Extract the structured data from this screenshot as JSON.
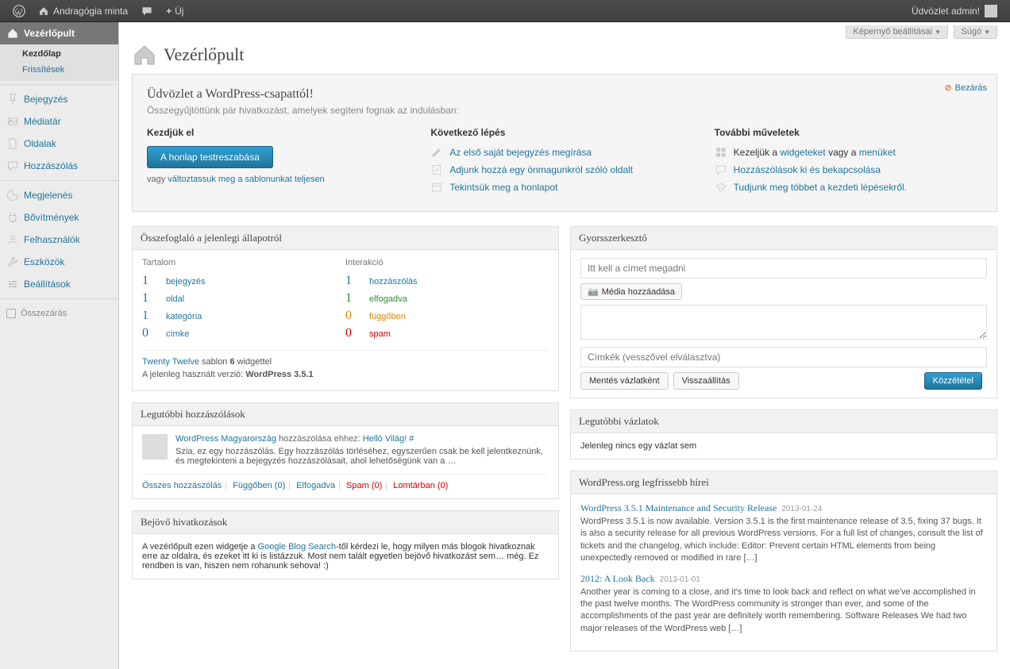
{
  "toolbar": {
    "site_name": "Andragógia minta",
    "new_label": "Új",
    "howdy": "Üdvözlet admin!"
  },
  "screen_meta": {
    "screen_options": "Képernyő beállításai",
    "help": "Súgó"
  },
  "page_title": "Vezérlőpult",
  "menu": {
    "dashboard": "Vezérlőpult",
    "home": "Kezdőlap",
    "updates": "Frissítések",
    "posts": "Bejegyzés",
    "media": "Médiatár",
    "pages": "Oldalak",
    "comments": "Hozzászólás",
    "appearance": "Megjelenés",
    "plugins": "Bővítmények",
    "users": "Felhasználók",
    "tools": "Eszközök",
    "settings": "Beállítások",
    "collapse": "Összezárás"
  },
  "welcome": {
    "title": "Üdvözlet a WordPress-csapattól!",
    "sub": "Összegyűjtöttünk pár hivatkozást, amelyek segíteni fognak az indulásban:",
    "close": "Bezárás",
    "col1_title": "Kezdjük el",
    "customize_btn": "A honlap testreszabása",
    "or_prefix": "vagy ",
    "or_link": "változtassuk meg a sablonunkat teljesen",
    "col2_title": "Következő lépés",
    "c2_l1": "Az első saját bejegyzés megírása",
    "c2_l2": "Adjunk hozzá egy önmagunkról szóló oldalt",
    "c2_l3": "Tekintsük meg a honlapot",
    "col3_title": "További műveletek",
    "c3_prefix": "Kezeljük a ",
    "c3_widgets": "widgeteket",
    "c3_or": " vagy a ",
    "c3_menus": "menüket",
    "c3_l2": "Hozzászólások ki és bekapcsolása",
    "c3_l3": "Tudjunk meg többet a kezdeti lépésekről."
  },
  "rightnow": {
    "title": "Összefoglaló a jelenlegi állapotról",
    "content_h": "Tartalom",
    "discuss_h": "Interakció",
    "rows_content": [
      {
        "n": "1",
        "l": "bejegyzés"
      },
      {
        "n": "1",
        "l": "oldal"
      },
      {
        "n": "1",
        "l": "kategória"
      },
      {
        "n": "0",
        "l": "címke"
      }
    ],
    "rows_disc": [
      {
        "n": "1",
        "l": "hozzászólás",
        "c": ""
      },
      {
        "n": "1",
        "l": "elfogadva",
        "c": "green"
      },
      {
        "n": "0",
        "l": "függőben",
        "c": "orange"
      },
      {
        "n": "0",
        "l": "spam",
        "c": "red"
      }
    ],
    "theme_name": "Twenty Twelve",
    "theme_mid": " sablon ",
    "widget_count": "6",
    "theme_suffix": " widgettel",
    "version_prefix": "A jelenleg használt verzió: ",
    "version": "WordPress 3.5.1"
  },
  "recent_comments": {
    "title": "Legutóbbi hozzászólások",
    "author": "WordPress Magyarország",
    "meta_mid": " hozzászólása ehhez: ",
    "post": "Helló Világ! #",
    "text": "Szia, ez egy hozzászólás. Egy hozzászólás törléséhez, egyszerűen csak be kell jelentkeznünk, és megtekinteni a bejegyzés hozzászólásait, ahol lehetőségünk van a …",
    "all": "Összes hozzászólás",
    "pending": "Függőben",
    "pending_n": "(0)",
    "approved": "Elfogadva",
    "spam": "Spam",
    "spam_n": "(0)",
    "trash": "Lomtárban",
    "trash_n": "(0)"
  },
  "incoming": {
    "title": "Bejövő hivatkozások",
    "text_pre": "A vezérlőpult ezen widgetje a ",
    "link": "Google Blog Search",
    "text_post": "-től kérdezi le, hogy milyen más blogok hivatkoznak erre az oldalra, és ezeket itt ki is listázzuk. Most nem talált egyetlen bejövő hivatkozást sem… még. Ez rendben is van, hiszen nem rohanunk sehova! :)"
  },
  "quickpress": {
    "title": "Gyorsszerkesztő",
    "title_ph": "Itt kell a címet megadni",
    "media": "Média hozzáadása",
    "tags_ph": "Címkék (vesszővel elválasztva)",
    "save": "Mentés vázlatként",
    "reset": "Visszaállítás",
    "publish": "Közzététel"
  },
  "drafts": {
    "title": "Legutóbbi vázlatok",
    "empty": "Jelenleg nincs egy vázlat sem"
  },
  "news": {
    "title": "WordPress.org legfrissebb hírei",
    "items": [
      {
        "title": "WordPress 3.5.1 Maintenance and Security Release",
        "date": "2013-01-24",
        "excerpt": "WordPress 3.5.1 is now available. Version 3.5.1 is the first maintenance release of 3.5, fixing 37 bugs. It is also a security release for all previous WordPress versions. For a full list of changes, consult the list of tickets and the changelog, which include: Editor: Prevent certain HTML elements from being unexpectedly removed or modified in rare […]"
      },
      {
        "title": "2012: A Look Back",
        "date": "2013-01-01",
        "excerpt": "Another year is coming to a close, and it's time to look back and reflect on what we've accomplished in the past twelve months. The WordPress community is stronger than ever, and some of the accomplishments of the past year are definitely worth remembering. Software Releases We had two major releases of the WordPress web […]"
      }
    ]
  }
}
